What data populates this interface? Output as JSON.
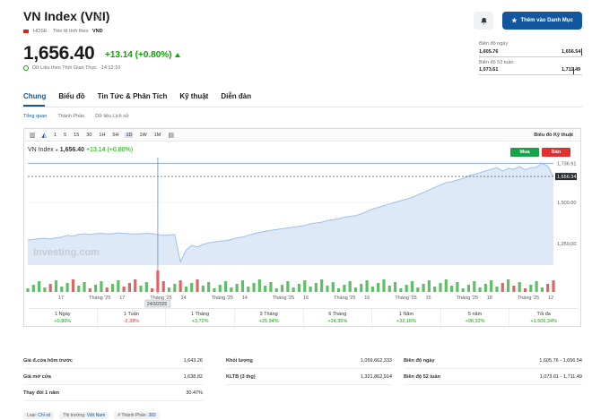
{
  "header": {
    "title": "VN Index (VNI)",
    "exchange": "HOSE",
    "currency_note": "Tiền tệ tính theo",
    "currency": "VND",
    "price": "1,656.40",
    "change": "+13.14 (+0.80%)",
    "realtime_note": "Dữ Liệu theo Thời Gian Thực · 14:12:10",
    "watchlist_label": "Thêm vào Danh Mục"
  },
  "ranges": {
    "day_label": "Biên độ ngày",
    "day_low": "1,605.76",
    "day_high": "1,656.54",
    "day_level": 0.99,
    "week52_label": "Biên độ 52 tuần",
    "week52_low": "1,073.61",
    "week52_high": "1,711.49",
    "week52_level": 0.91
  },
  "tabs": [
    "Chung",
    "Biểu đồ",
    "Tin Tức & Phân Tích",
    "Kỹ thuật",
    "Diễn đàn"
  ],
  "subtabs": [
    "Tổng quan",
    "Thành Phần",
    "Dữ liệu Lịch sử"
  ],
  "toolbar": {
    "timeframes": [
      "1",
      "5",
      "15",
      "30",
      "1H",
      "5H",
      "1D",
      "1W",
      "1M"
    ],
    "selected": "1D",
    "tech_chart": "Biểu đồ Kỹ thuật"
  },
  "chart_head": {
    "name": "VN Index",
    "price": "1,656.40",
    "change": "+13.14 (+0.80%)",
    "buy": "Mua",
    "sell": "Bán"
  },
  "chart_data": {
    "type": "area",
    "y_ticks": [
      "1,736.91",
      "1,500.00",
      "1,250.00"
    ],
    "y_tick_values": [
      1736.91,
      1500,
      1250
    ],
    "ylim": [
      1120,
      1760
    ],
    "current_label": "1,656.34",
    "current_value": 1656.34,
    "x_labels": [
      "17",
      "Tháng '25",
      "17",
      "Tháng '25",
      "14",
      "Tháng '25",
      "14",
      "Tháng '25",
      "16",
      "Tháng '25",
      "16",
      "Tháng '25",
      "15",
      "Tháng '25",
      "18",
      "Tháng '25",
      "12"
    ],
    "crosshair_label": "24/3/2025",
    "watermark": "Investing.com",
    "values": [
      1270,
      1275,
      1280,
      1282,
      1278,
      1285,
      1290,
      1300,
      1295,
      1305,
      1310,
      1305,
      1310,
      1312,
      1308,
      1310,
      1315,
      1312,
      1310,
      1308,
      1310,
      1312,
      1310,
      1305,
      1300,
      1302,
      1305,
      1140,
      1210,
      1240,
      1230,
      1245,
      1255,
      1260,
      1265,
      1268,
      1275,
      1285,
      1290,
      1300,
      1310,
      1318,
      1325,
      1330,
      1335,
      1340,
      1345,
      1350,
      1355,
      1360,
      1370,
      1375,
      1380,
      1390,
      1395,
      1400,
      1410,
      1415,
      1420,
      1430,
      1445,
      1460,
      1470,
      1480,
      1490,
      1500,
      1510,
      1520,
      1530,
      1545,
      1560,
      1575,
      1590,
      1605,
      1620,
      1625,
      1635,
      1645,
      1660,
      1670,
      1680,
      1690,
      1700,
      1710,
      1690,
      1705,
      1700,
      1716,
      1698,
      1710,
      1712,
      1736,
      1720,
      1656
    ]
  },
  "performance": [
    {
      "label": "1 Ngày",
      "value": "+0,80%",
      "dir": "pos"
    },
    {
      "label": "1 Tuần",
      "value": "-2,38%",
      "dir": "neg"
    },
    {
      "label": "1 Tháng",
      "value": "+3,72%",
      "dir": "pos"
    },
    {
      "label": "3 Tháng",
      "value": "+25,94%",
      "dir": "pos"
    },
    {
      "label": "6 Tháng",
      "value": "+24,35%",
      "dir": "pos"
    },
    {
      "label": "1 Năm",
      "value": "+32,16%",
      "dir": "pos"
    },
    {
      "label": "5 năm",
      "value": "+98,32%",
      "dir": "pos"
    },
    {
      "label": "Tối đa",
      "value": "+1.506,34%",
      "dir": "pos"
    }
  ],
  "stats": {
    "col1": [
      {
        "k": "Giá đ.cửa hôm trước",
        "v": "1,643.26"
      },
      {
        "k": "Giá mở cửa",
        "v": "1,638.82"
      },
      {
        "k": "Thay đổi 1 năm",
        "v": "30.47%"
      }
    ],
    "col2": [
      {
        "k": "Khối lượng",
        "v": "1,059,662,333"
      },
      {
        "k": "KLTB (3 thg)",
        "v": "1,321,862,914"
      }
    ],
    "col3": [
      {
        "k": "Biên độ ngày",
        "v": "1,605.76 - 1,656.54"
      },
      {
        "k": "Biên độ 52 tuần",
        "v": "1,073.61 - 1,711.49"
      }
    ]
  },
  "footer": {
    "type_label": "Loại:",
    "type_value": "Chỉ số",
    "market_label": "Thị trường:",
    "market_value": "Việt Nam",
    "members_label": "# Thành Phần:",
    "members_value": "383"
  }
}
